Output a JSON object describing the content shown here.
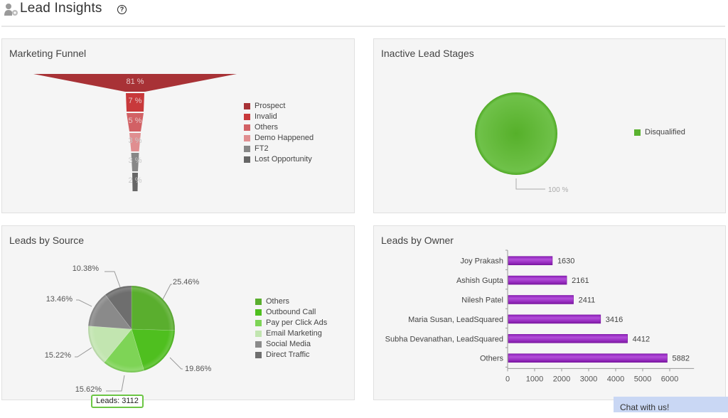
{
  "header": {
    "title": "Lead Insights",
    "page_icon": "lead-insights-icon",
    "help_icon": "help-icon",
    "help_glyph": "?"
  },
  "panels": {
    "funnel": {
      "title": "Marketing Funnel"
    },
    "inactive": {
      "title": "Inactive Lead Stages"
    },
    "source": {
      "title": "Leads by Source"
    },
    "owner": {
      "title": "Leads by Owner"
    }
  },
  "tooltip": {
    "text": "Leads: 3112"
  },
  "chat": {
    "label": "Chat with us!"
  },
  "chart_data": [
    {
      "id": "marketing-funnel",
      "type": "funnel",
      "title": "Marketing Funnel",
      "categories": [
        "Prospect",
        "Invalid",
        "Others",
        "Demo Happened",
        "FT2",
        "Lost Opportunity"
      ],
      "values": [
        81,
        7,
        5,
        3,
        3,
        2
      ],
      "labels": [
        "81 %",
        "7 %",
        "5 %",
        "3 %",
        "3 %",
        "2 %"
      ],
      "colors": [
        "#a83236",
        "#c8393b",
        "#d26165",
        "#e08e90",
        "#878787",
        "#666666"
      ],
      "legend": "right"
    },
    {
      "id": "inactive-lead-stages",
      "type": "pie",
      "title": "Inactive Lead Stages",
      "categories": [
        "Disqualified"
      ],
      "values": [
        100
      ],
      "labels": [
        "100 %"
      ],
      "colors": [
        "#5ab22f"
      ],
      "legend": "right"
    },
    {
      "id": "leads-by-source",
      "type": "pie",
      "title": "Leads by Source",
      "categories": [
        "Others",
        "Outbound Call",
        "Pay per Click Ads",
        "Email Marketing",
        "Social Media",
        "Direct Traffic"
      ],
      "values": [
        25.46,
        19.86,
        15.62,
        15.22,
        13.46,
        10.38
      ],
      "labels": [
        "25.46%",
        "19.86%",
        "15.62%",
        "15.22%",
        "13.46%",
        "10.38%"
      ],
      "colors": [
        "#5aae2e",
        "#4fbf1f",
        "#7ed456",
        "#c2e5b0",
        "#8a8a8a",
        "#6e6e6e"
      ],
      "legend": "right"
    },
    {
      "id": "leads-by-owner",
      "type": "bar",
      "orientation": "horizontal",
      "title": "Leads by Owner",
      "categories": [
        "Joy Prakash",
        "Ashish Gupta",
        "Nilesh Patel",
        "Maria Susan, LeadSquared",
        "Subha Devanathan, LeadSquared",
        "Others"
      ],
      "values": [
        1630,
        2161,
        2411,
        3416,
        4412,
        5882
      ],
      "xlim": [
        0,
        6900
      ],
      "xticks": [
        0,
        1000,
        2000,
        3000,
        4000,
        5000,
        6000
      ],
      "color": "#9a2fc3",
      "legend": "none"
    }
  ]
}
